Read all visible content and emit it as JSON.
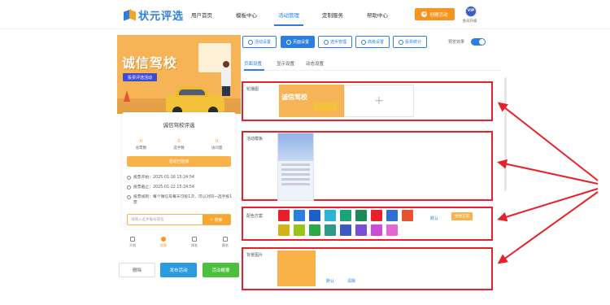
{
  "brand": {
    "name": "状元评选"
  },
  "nav": {
    "items": [
      {
        "label": "用户首页"
      },
      {
        "label": "模板中心"
      },
      {
        "label": "活动管理"
      },
      {
        "label": "定制服务"
      },
      {
        "label": "帮助中心"
      }
    ],
    "active_index": 2,
    "create_label": "创建活动",
    "vip_badge": "VIP",
    "vip_label": "会员升级"
  },
  "preview": {
    "banner_title": "诚信驾校",
    "banner_subtitle": "投票评选活动",
    "card_title": "诚信驾校评选",
    "stats": [
      {
        "value": "0",
        "label": "总票数"
      },
      {
        "value": "0",
        "label": "选手数"
      },
      {
        "value": "0",
        "label": "访问量"
      }
    ],
    "enter_label": "活动已结束",
    "vote_start": "投票开始：2025-01-16 15:24:54",
    "vote_end": "投票截止：2025-01-22 15:24:54",
    "vote_rule": "投票规则：每个微信号每天可投1次，可以对同一选手投1票",
    "search_placeholder": "请输入选手编号或名",
    "search_button": "搜索",
    "tabbar": [
      {
        "label": "介绍",
        "icon": "home-icon"
      },
      {
        "label": "投票",
        "icon": "user-icon"
      },
      {
        "label": "排名",
        "icon": "rank-icon"
      },
      {
        "label": "报名",
        "icon": "signup-icon"
      }
    ],
    "tabbar_active": 1
  },
  "actions": {
    "delete_label": "删除",
    "publish_label": "发布活动",
    "save_label": "活动概要"
  },
  "toolbar": {
    "buttons": [
      {
        "label": "活动设置",
        "icon": "settings-icon"
      },
      {
        "label": "页面设置",
        "icon": "page-icon"
      },
      {
        "label": "选手管理",
        "icon": "users-icon"
      },
      {
        "label": "高级设置",
        "icon": "advanced-icon"
      },
      {
        "label": "投票统计",
        "icon": "stats-icon"
      }
    ],
    "active_index": 1,
    "preview_effect_label": "预览效果",
    "preview_effect_on": true
  },
  "subtabs": {
    "items": [
      {
        "label": "页面设置"
      },
      {
        "label": "显示设置"
      },
      {
        "label": "动态设置"
      }
    ],
    "active_index": 0
  },
  "sections": {
    "carousel": {
      "label": "轮播图",
      "thumb_text": "诚信驾校",
      "add_symbol": "+"
    },
    "template": {
      "label": "活动模板"
    },
    "colors": {
      "label": "配色方案",
      "swatches": [
        "#e8202a",
        "#2b7fe0",
        "#1a62c7",
        "#2bb3d6",
        "#1aa37a",
        "#1a8a5a",
        "#e8202a",
        "#2f6fd6",
        "#e8532f",
        "#d4b21a",
        "#9ac21a",
        "#2ba84a",
        "#2b9b8a",
        "#3a5bbf",
        "#7a4fd6",
        "#c94fd6",
        "#e06ad0"
      ],
      "default_label": "默认",
      "select_label": "更换方案"
    },
    "background": {
      "label": "背景图片",
      "default_label": "默认",
      "clear_label": "清除"
    }
  },
  "colors": {
    "accent": "#2b7fe0",
    "orange": "#f7941d",
    "highlight_border": "#e8202a"
  }
}
